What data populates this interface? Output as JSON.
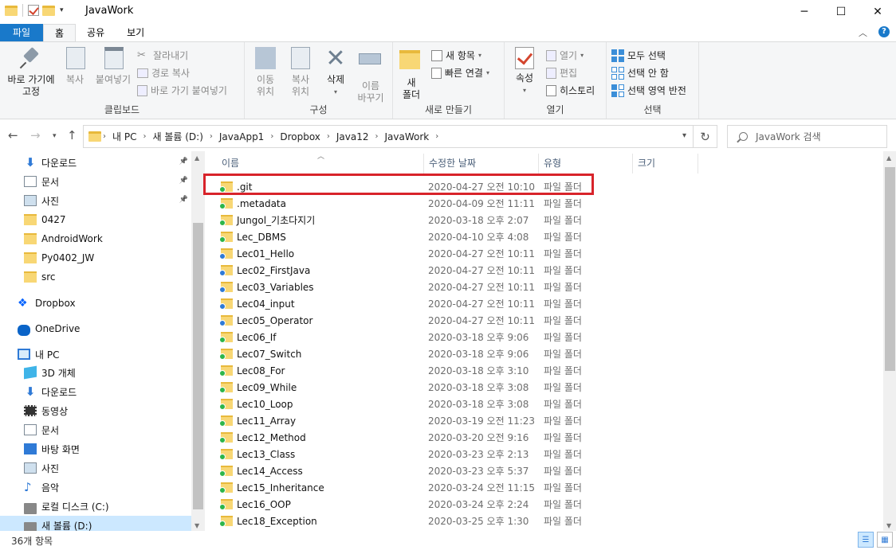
{
  "window": {
    "title": "JavaWork",
    "minimize": "─",
    "maximize": "☐",
    "close": "✕"
  },
  "ribbon_tabs": [
    {
      "label": "파일"
    },
    {
      "label": "홈"
    },
    {
      "label": "공유"
    },
    {
      "label": "보기"
    }
  ],
  "ribbon": {
    "clipboard": {
      "pin": "바로 가기에\n고정",
      "copy": "복사",
      "paste": "붙여넣기",
      "cut": "잘라내기",
      "copy_path": "경로 복사",
      "paste_shortcut": "바로 가기 붙여넣기",
      "label": "클립보드"
    },
    "organize": {
      "move": "이동\n위치",
      "copyto": "복사\n위치",
      "delete": "삭제",
      "rename": "이름\n바꾸기",
      "label": "구성"
    },
    "new": {
      "new_folder": "새\n폴더",
      "new_item": "새 항목",
      "easy_access": "빠른 연결",
      "label": "새로 만들기"
    },
    "open": {
      "properties": "속성",
      "open": "열기",
      "edit": "편집",
      "history": "히스토리",
      "label": "열기"
    },
    "select": {
      "select_all": "모두 선택",
      "select_none": "선택 안 함",
      "invert": "선택 영역 반전",
      "label": "선택"
    }
  },
  "address": {
    "crumbs": [
      "내 PC",
      "새 볼륨 (D:)",
      "JavaApp1",
      "Dropbox",
      "Java12",
      "JavaWork"
    ],
    "search_placeholder": "JavaWork 검색"
  },
  "nav_pane": [
    {
      "label": "다운로드",
      "icon": "download-icon",
      "pinned": true
    },
    {
      "label": "문서",
      "icon": "document-icon",
      "pinned": true
    },
    {
      "label": "사진",
      "icon": "picture-icon",
      "pinned": true
    },
    {
      "label": "0427",
      "icon": "folder-icon"
    },
    {
      "label": "AndroidWork",
      "icon": "folder-icon"
    },
    {
      "label": "Py0402_JW",
      "icon": "folder-icon"
    },
    {
      "label": "src",
      "icon": "folder-icon"
    },
    {
      "label": "Dropbox",
      "icon": "dropbox-icon"
    },
    {
      "label": "OneDrive",
      "icon": "onedrive-icon"
    },
    {
      "label": "내 PC",
      "icon": "pc-icon"
    },
    {
      "label": "3D 개체",
      "icon": "3d-objects-icon"
    },
    {
      "label": "다운로드",
      "icon": "download-icon"
    },
    {
      "label": "동영상",
      "icon": "video-icon"
    },
    {
      "label": "문서",
      "icon": "document-icon"
    },
    {
      "label": "바탕 화면",
      "icon": "desktop-icon"
    },
    {
      "label": "사진",
      "icon": "picture-icon"
    },
    {
      "label": "음악",
      "icon": "music-icon"
    },
    {
      "label": "로컬 디스크 (C:)",
      "icon": "drive-icon"
    },
    {
      "label": "새 볼륨 (D:)",
      "icon": "drive-icon",
      "selected": true
    }
  ],
  "columns": [
    "이름",
    "수정한 날짜",
    "유형",
    "크기"
  ],
  "files": [
    {
      "name": ".git",
      "date": "2020-04-27 오전 10:10",
      "type": "파일 폴더",
      "sync": "synced"
    },
    {
      "name": ".metadata",
      "date": "2020-04-09 오전 11:11",
      "type": "파일 폴더",
      "sync": "synced"
    },
    {
      "name": "Jungol_기초다지기",
      "date": "2020-03-18 오후 2:07",
      "type": "파일 폴더",
      "sync": "synced"
    },
    {
      "name": "Lec_DBMS",
      "date": "2020-04-10 오후 4:08",
      "type": "파일 폴더",
      "sync": "synced"
    },
    {
      "name": "Lec01_Hello",
      "date": "2020-04-27 오전 10:11",
      "type": "파일 폴더",
      "sync": "syncing"
    },
    {
      "name": "Lec02_FirstJava",
      "date": "2020-04-27 오전 10:11",
      "type": "파일 폴더",
      "sync": "syncing"
    },
    {
      "name": "Lec03_Variables",
      "date": "2020-04-27 오전 10:11",
      "type": "파일 폴더",
      "sync": "syncing"
    },
    {
      "name": "Lec04_input",
      "date": "2020-04-27 오전 10:11",
      "type": "파일 폴더",
      "sync": "syncing"
    },
    {
      "name": "Lec05_Operator",
      "date": "2020-04-27 오전 10:11",
      "type": "파일 폴더",
      "sync": "syncing"
    },
    {
      "name": "Lec06_If",
      "date": "2020-03-18 오후 9:06",
      "type": "파일 폴더",
      "sync": "synced"
    },
    {
      "name": "Lec07_Switch",
      "date": "2020-03-18 오후 9:06",
      "type": "파일 폴더",
      "sync": "synced"
    },
    {
      "name": "Lec08_For",
      "date": "2020-03-18 오후 3:10",
      "type": "파일 폴더",
      "sync": "synced"
    },
    {
      "name": "Lec09_While",
      "date": "2020-03-18 오후 3:08",
      "type": "파일 폴더",
      "sync": "synced"
    },
    {
      "name": "Lec10_Loop",
      "date": "2020-03-18 오후 3:08",
      "type": "파일 폴더",
      "sync": "synced"
    },
    {
      "name": "Lec11_Array",
      "date": "2020-03-19 오전 11:23",
      "type": "파일 폴더",
      "sync": "synced"
    },
    {
      "name": "Lec12_Method",
      "date": "2020-03-20 오전 9:16",
      "type": "파일 폴더",
      "sync": "synced"
    },
    {
      "name": "Lec13_Class",
      "date": "2020-03-23 오후 2:13",
      "type": "파일 폴더",
      "sync": "synced"
    },
    {
      "name": "Lec14_Access",
      "date": "2020-03-23 오후 5:37",
      "type": "파일 폴더",
      "sync": "synced"
    },
    {
      "name": "Lec15_Inheritance",
      "date": "2020-03-24 오전 11:15",
      "type": "파일 폴더",
      "sync": "synced"
    },
    {
      "name": "Lec16_OOP",
      "date": "2020-03-24 오후 2:24",
      "type": "파일 폴더",
      "sync": "synced"
    },
    {
      "name": "Lec18_Exception",
      "date": "2020-03-25 오후 1:30",
      "type": "파일 폴더",
      "sync": "synced"
    }
  ],
  "status": {
    "item_count": "36개 항목"
  },
  "colors": {
    "accent": "#1979ca",
    "selection": "#cce8ff",
    "highlight_box": "#d8232a"
  }
}
